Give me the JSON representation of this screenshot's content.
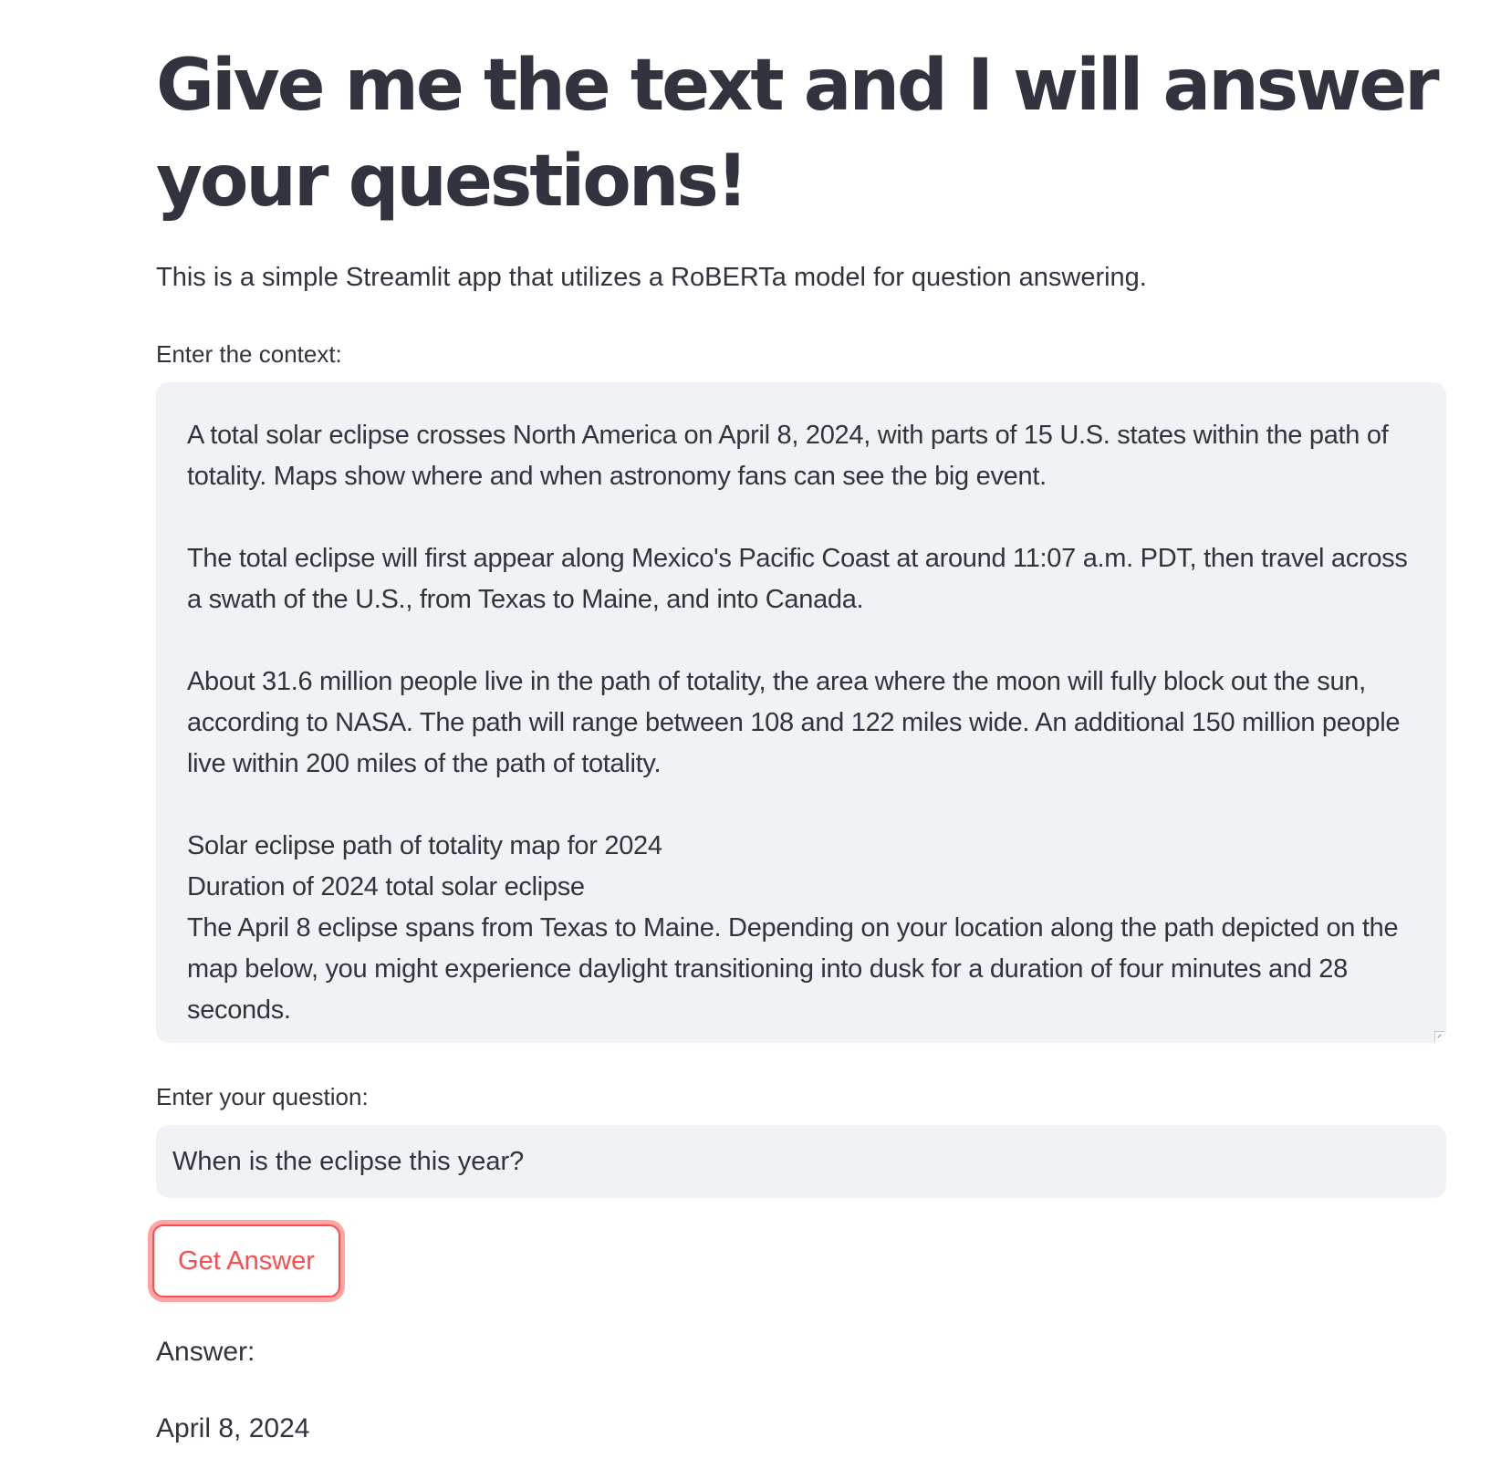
{
  "header": {
    "title": "Give me the text and I will answer your questions!",
    "subtitle": "This is a simple Streamlit app that utilizes a RoBERTa model for question answering."
  },
  "context_field": {
    "label": "Enter the context:",
    "paragraphs": [
      "A total solar eclipse crosses North America on April 8, 2024, with parts of 15 U.S. states within the path of totality. Maps show where and when astronomy fans can see the big event.",
      "The total eclipse will first appear along Mexico's Pacific Coast at around 11:07 a.m. PDT, then travel across a swath of the U.S., from Texas to Maine, and into Canada.",
      "About 31.6 million people live in the path of totality, the area where the moon will fully block out the sun, according to NASA. The path will range between 108 and 122 miles wide. An additional 150 million people live within 200 miles of the path of totality.",
      "Solar eclipse path of totality map for 2024",
      "Duration of 2024 total solar eclipse",
      "The April 8 eclipse spans from Texas to Maine. Depending on your location along the path depicted on the map below, you might experience daylight transitioning into dusk for a duration of four minutes and 28 seconds."
    ]
  },
  "question_field": {
    "label": "Enter your question:",
    "value": "When is the eclipse this year?"
  },
  "actions": {
    "get_answer_label": "Get Answer"
  },
  "answer": {
    "label": "Answer:",
    "value": "April 8, 2024"
  },
  "colors": {
    "text": "#31333f",
    "input_background": "#f0f2f6",
    "primary": "#ff4b4b"
  }
}
